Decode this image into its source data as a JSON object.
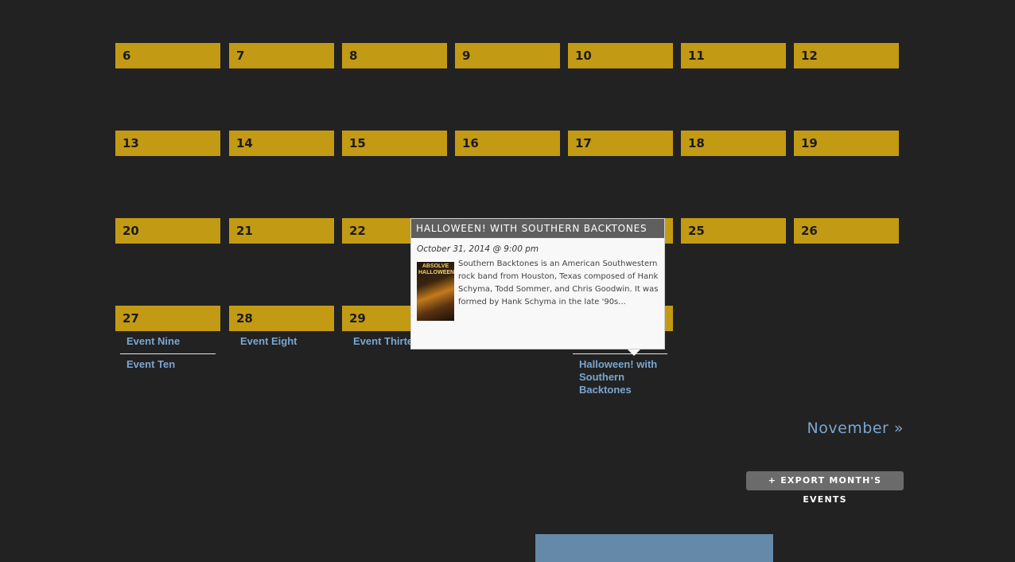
{
  "calendar": {
    "weeks": [
      [
        "6",
        "7",
        "8",
        "9",
        "10",
        "11",
        "12"
      ],
      [
        "13",
        "14",
        "15",
        "16",
        "17",
        "18",
        "19"
      ],
      [
        "20",
        "21",
        "22",
        "",
        "",
        "25",
        "26"
      ],
      [
        "27",
        "28",
        "29",
        "",
        "",
        "",
        ""
      ]
    ],
    "events": {
      "day27": [
        "Event Nine",
        "Event Ten"
      ],
      "day28": [
        "Event Eight"
      ],
      "day29": [
        "Event Thirte"
      ],
      "day31": [
        "Halloween! with Southern Backtones"
      ]
    }
  },
  "tooltip": {
    "title": "Halloween! with Southern Backtones",
    "date": "October 31, 2014 @ 9:00 pm",
    "poster_text": "ABSOLVE HALLOWEEN",
    "description": "Southern Backtones is an American Southwestern rock band from Houston, Texas composed of Hank Schyma, Todd Sommer, and Chris Goodwin. It was formed by Hank Schyma in the late '90s..."
  },
  "navigation": {
    "next_month": "November »"
  },
  "export": {
    "label": "+ Export Month's Events"
  },
  "colors": {
    "day_header": "#c39a14",
    "link": "#7aa6cf",
    "background": "#222222"
  }
}
